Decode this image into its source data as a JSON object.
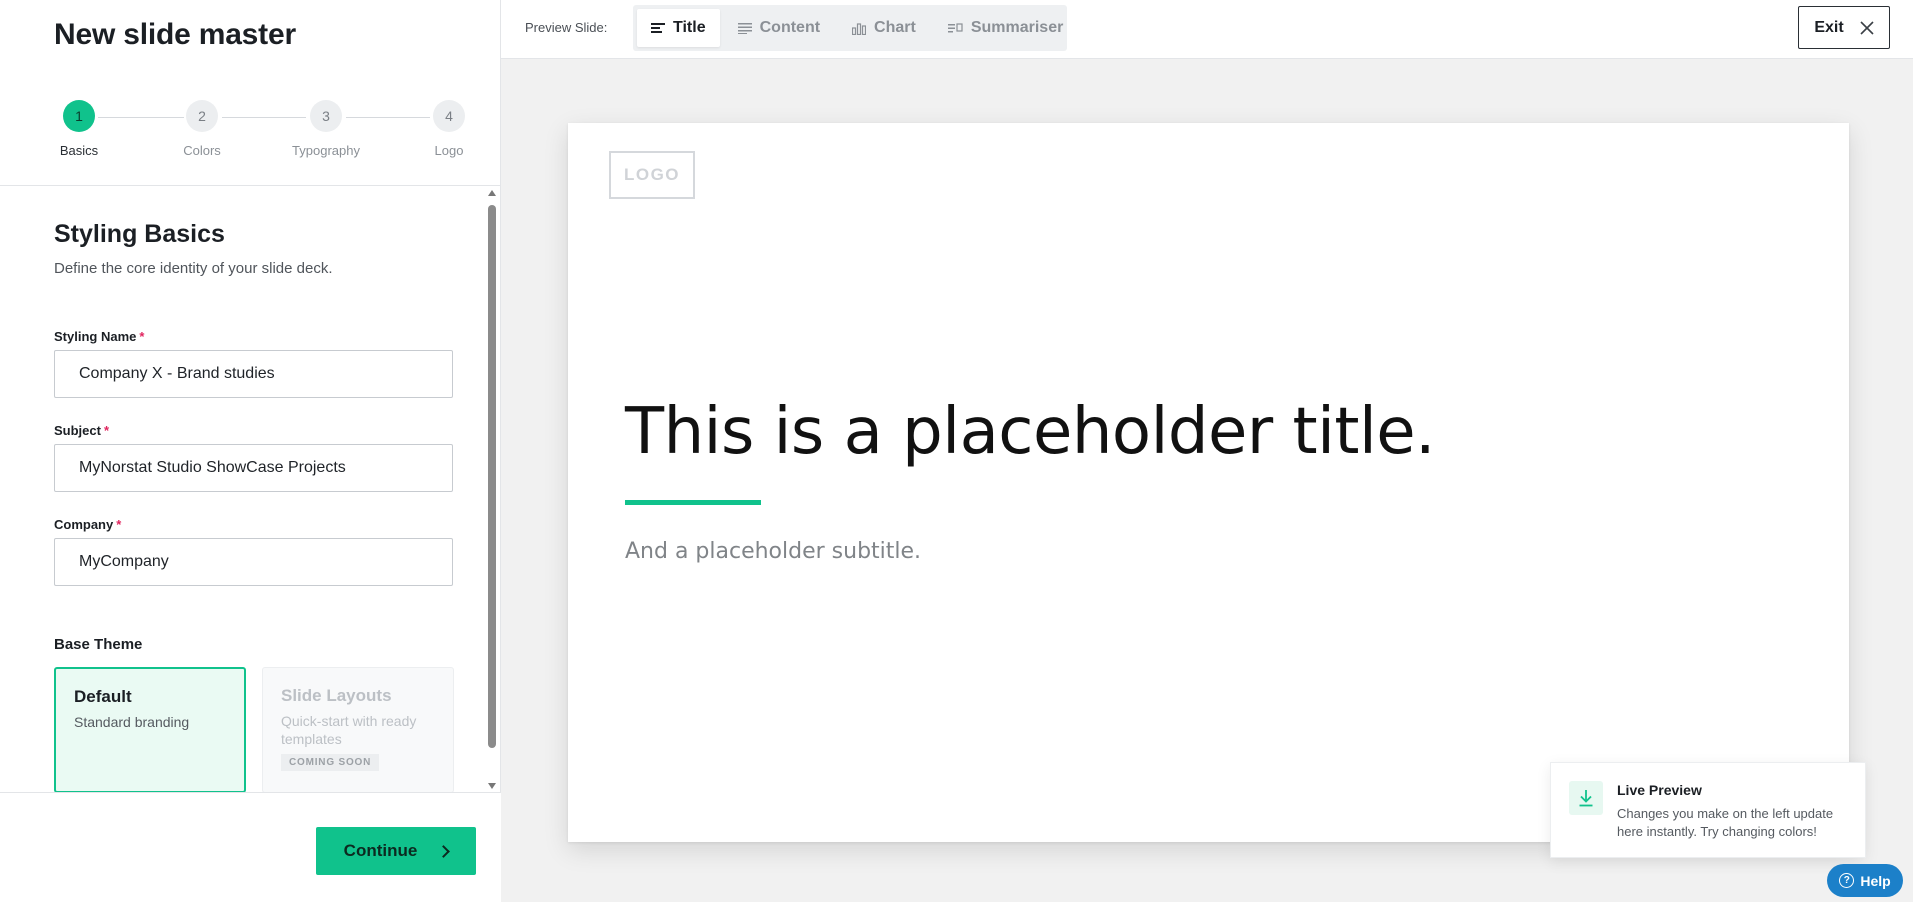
{
  "page": {
    "title": "New slide master"
  },
  "stepper": {
    "steps": [
      {
        "number": "1",
        "label": "Basics",
        "state": "active"
      },
      {
        "number": "2",
        "label": "Colors",
        "state": "pending"
      },
      {
        "number": "3",
        "label": "Typography",
        "state": "pending"
      },
      {
        "number": "4",
        "label": "Logo",
        "state": "pending"
      }
    ]
  },
  "section": {
    "title": "Styling Basics",
    "subtitle": "Define the core identity of your slide deck."
  },
  "form": {
    "required_mark": "*",
    "styling_name": {
      "label": "Styling Name",
      "value": "Company X - Brand studies"
    },
    "subject": {
      "label": "Subject",
      "value": "MyNorstat Studio ShowCase Projects"
    },
    "company": {
      "label": "Company",
      "value": "MyCompany"
    }
  },
  "theme": {
    "label": "Base Theme",
    "options": [
      {
        "title": "Default",
        "description": "Standard branding",
        "selected": true
      },
      {
        "title": "Slide Layouts",
        "description": "Quick-start with ready templates",
        "badge": "COMING SOON",
        "disabled": true
      }
    ]
  },
  "footer": {
    "continue_label": "Continue"
  },
  "preview": {
    "label": "Preview Slide:",
    "tabs": [
      {
        "label": "Title",
        "icon": "title-lines-icon",
        "active": true
      },
      {
        "label": "Content",
        "icon": "content-lines-icon",
        "active": false
      },
      {
        "label": "Chart",
        "icon": "bar-chart-icon",
        "active": false
      },
      {
        "label": "Summariser",
        "icon": "summariser-icon",
        "active": false
      }
    ],
    "exit_label": "Exit"
  },
  "slide": {
    "logo_text": "LOGO",
    "title": "This is a placeholder title.",
    "subtitle": "And a placeholder subtitle."
  },
  "toast": {
    "title": "Live Preview",
    "text": "Changes you make on the left update here instantly. Try changing colors!",
    "icon": "download-arrow-icon"
  },
  "help": {
    "label": "Help",
    "icon": "question-circle-icon"
  },
  "colors": {
    "accent": "#10c28c",
    "help_blue": "#1c80c9",
    "required": "#e0245e",
    "preview_bg": "#f1f1f1"
  }
}
